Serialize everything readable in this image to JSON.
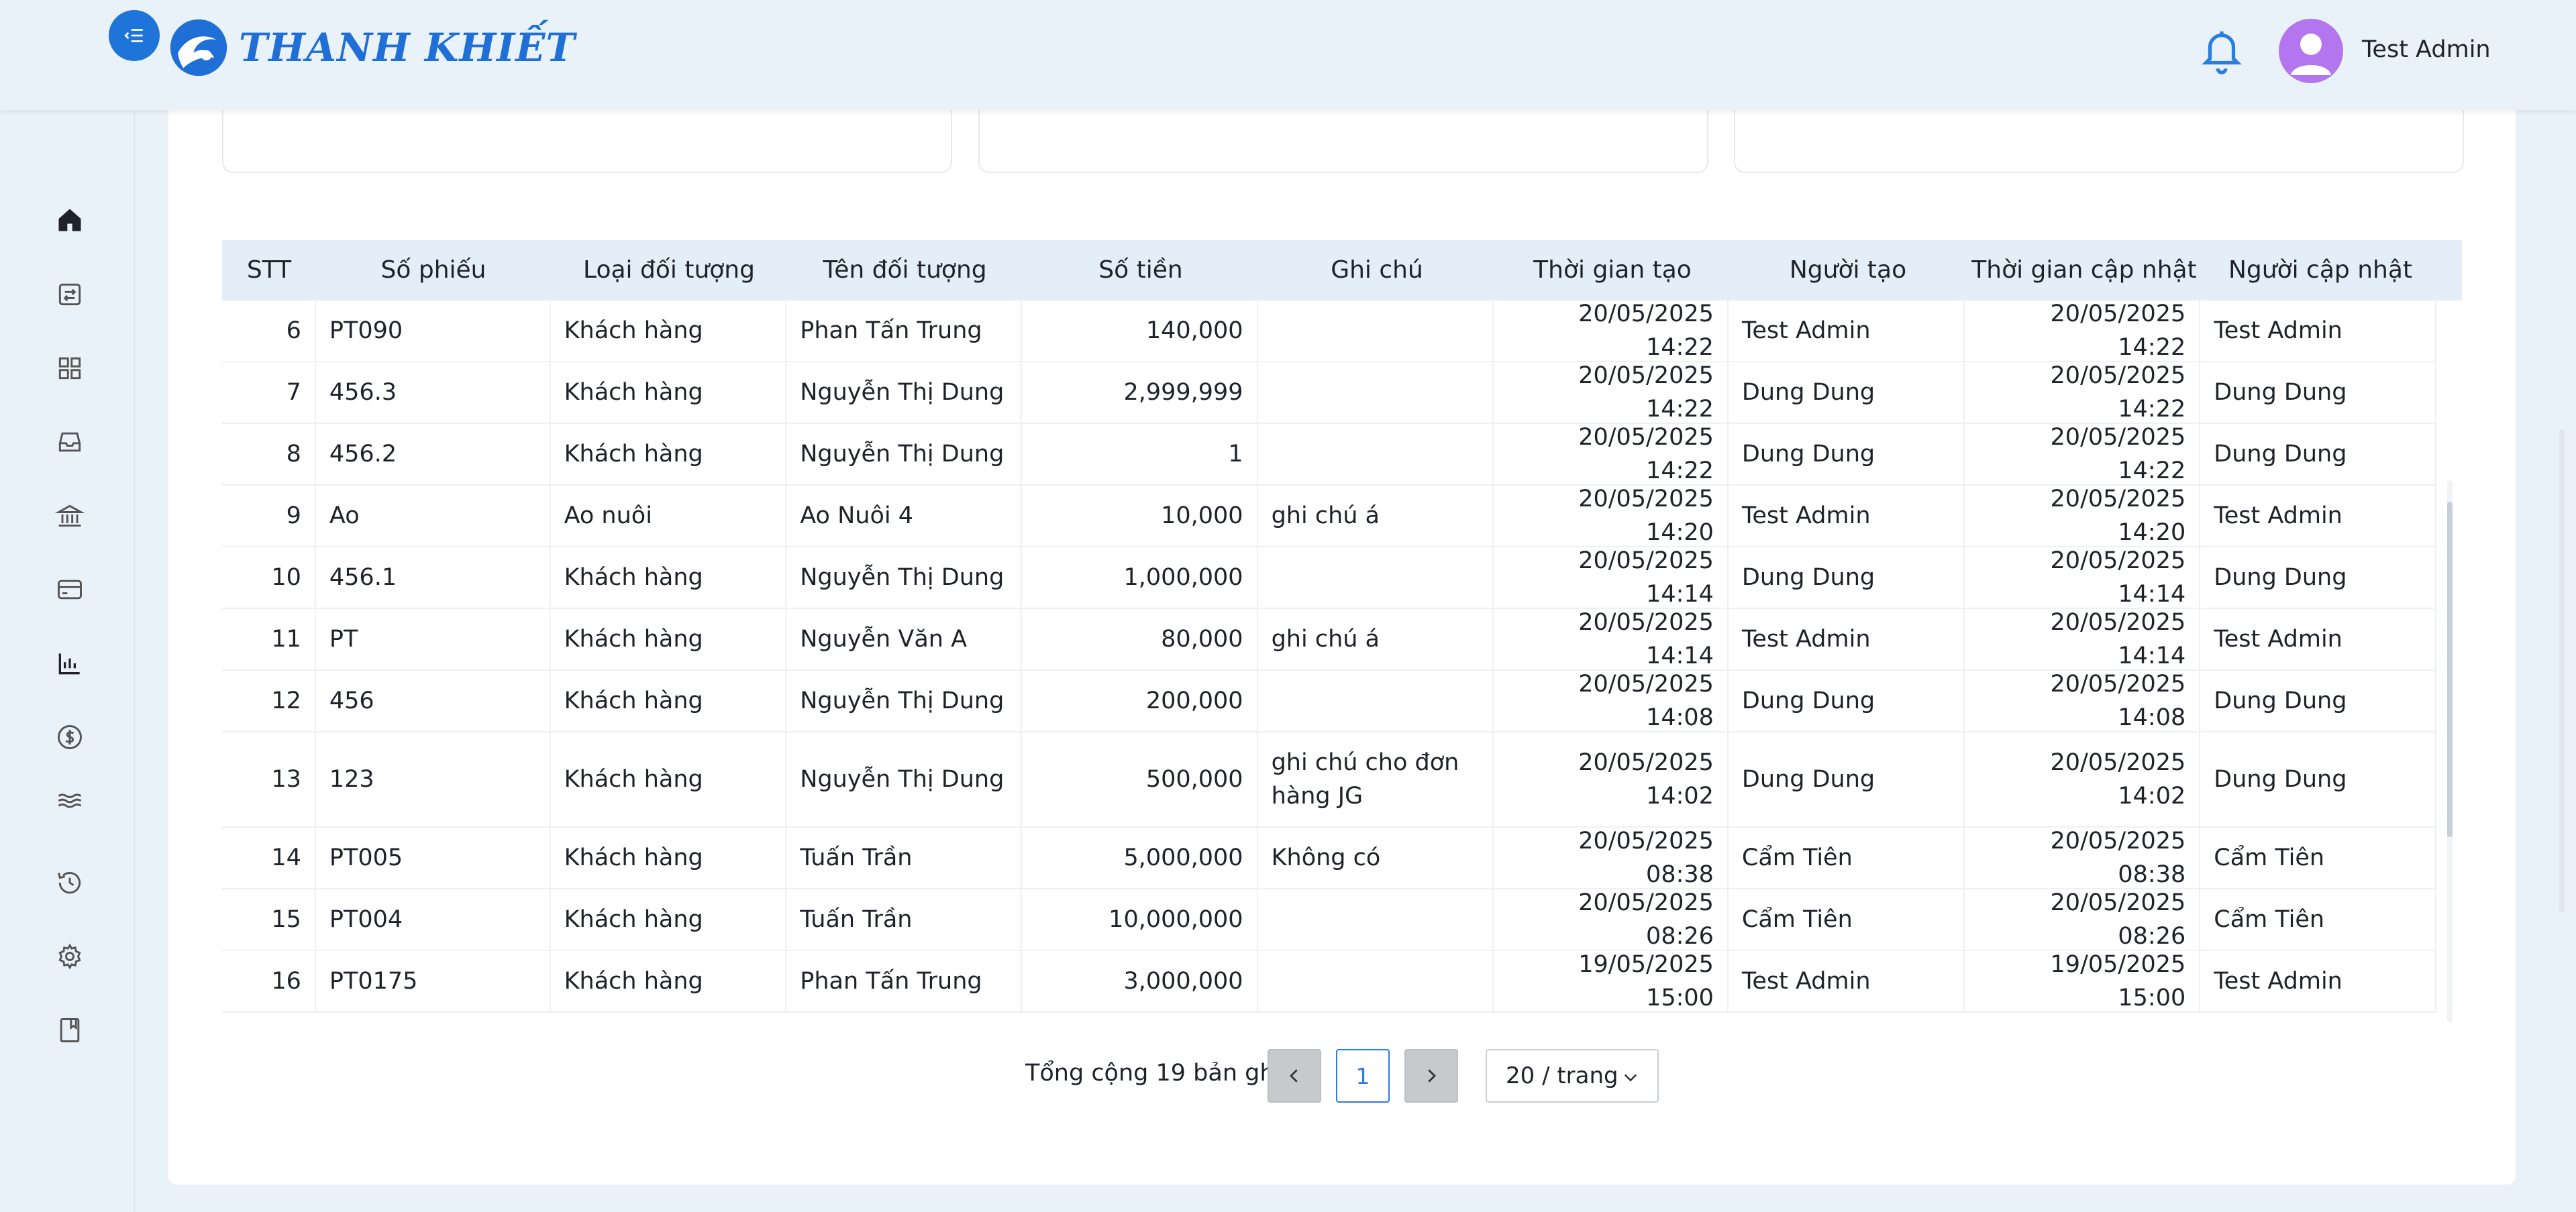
{
  "header": {
    "logo_text": "THANH KHIẾT",
    "user_name": "Test Admin"
  },
  "sidebar": {
    "items": [
      {
        "icon": "home-icon"
      },
      {
        "icon": "receipt-icon"
      },
      {
        "icon": "grid-icon"
      },
      {
        "icon": "inbox-icon"
      },
      {
        "icon": "bank-icon"
      },
      {
        "icon": "card-icon"
      },
      {
        "icon": "bar-chart-icon"
      },
      {
        "icon": "dollar-icon"
      },
      {
        "icon": "waves-icon"
      },
      {
        "icon": "history-icon"
      },
      {
        "icon": "gear-icon"
      },
      {
        "icon": "book-icon"
      }
    ]
  },
  "table": {
    "columns": [
      "STT",
      "Số phiếu",
      "Loại đối tượng",
      "Tên đối tượng",
      "Số tiền",
      "Ghi chú",
      "Thời gian tạo",
      "Người tạo",
      "Thời gian cập nhật",
      "Người cập nhật"
    ],
    "rows": [
      {
        "stt": "6",
        "so_phieu": "PT090",
        "loai": "Khách hàng",
        "ten": "Phan Tấn Trung",
        "so_tien": "140,000",
        "ghi_chu": "",
        "tg_tao": "20/05/2025 14:22",
        "nguoi_tao": "Test Admin",
        "tg_cap_nhat": "20/05/2025 14:22",
        "nguoi_cap_nhat": "Test Admin"
      },
      {
        "stt": "7",
        "so_phieu": "456.3",
        "loai": "Khách hàng",
        "ten": "Nguyễn Thị Dung",
        "so_tien": "2,999,999",
        "ghi_chu": "",
        "tg_tao": "20/05/2025 14:22",
        "nguoi_tao": "Dung Dung",
        "tg_cap_nhat": "20/05/2025 14:22",
        "nguoi_cap_nhat": "Dung Dung"
      },
      {
        "stt": "8",
        "so_phieu": "456.2",
        "loai": "Khách hàng",
        "ten": "Nguyễn Thị Dung",
        "so_tien": "1",
        "ghi_chu": "",
        "tg_tao": "20/05/2025 14:22",
        "nguoi_tao": "Dung Dung",
        "tg_cap_nhat": "20/05/2025 14:22",
        "nguoi_cap_nhat": "Dung Dung"
      },
      {
        "stt": "9",
        "so_phieu": "Ao",
        "loai": "Ao nuôi",
        "ten": "Ao Nuôi 4",
        "so_tien": "10,000",
        "ghi_chu": "ghi chú á",
        "tg_tao": "20/05/2025 14:20",
        "nguoi_tao": "Test Admin",
        "tg_cap_nhat": "20/05/2025 14:20",
        "nguoi_cap_nhat": "Test Admin"
      },
      {
        "stt": "10",
        "so_phieu": "456.1",
        "loai": "Khách hàng",
        "ten": "Nguyễn Thị Dung",
        "so_tien": "1,000,000",
        "ghi_chu": "",
        "tg_tao": "20/05/2025 14:14",
        "nguoi_tao": "Dung Dung",
        "tg_cap_nhat": "20/05/2025 14:14",
        "nguoi_cap_nhat": "Dung Dung"
      },
      {
        "stt": "11",
        "so_phieu": "PT",
        "loai": "Khách hàng",
        "ten": "Nguyễn Văn A",
        "so_tien": "80,000",
        "ghi_chu": "ghi chú á",
        "tg_tao": "20/05/2025 14:14",
        "nguoi_tao": "Test Admin",
        "tg_cap_nhat": "20/05/2025 14:14",
        "nguoi_cap_nhat": "Test Admin"
      },
      {
        "stt": "12",
        "so_phieu": "456",
        "loai": "Khách hàng",
        "ten": "Nguyễn Thị Dung",
        "so_tien": "200,000",
        "ghi_chu": "",
        "tg_tao": "20/05/2025 14:08",
        "nguoi_tao": "Dung Dung",
        "tg_cap_nhat": "20/05/2025 14:08",
        "nguoi_cap_nhat": "Dung Dung"
      },
      {
        "stt": "13",
        "so_phieu": "123",
        "loai": "Khách hàng",
        "ten": "Nguyễn Thị Dung",
        "so_tien": "500,000",
        "ghi_chu": "ghi chú cho đơn hàng JG",
        "tg_tao": "20/05/2025 14:02",
        "nguoi_tao": "Dung Dung",
        "tg_cap_nhat": "20/05/2025 14:02",
        "nguoi_cap_nhat": "Dung Dung"
      },
      {
        "stt": "14",
        "so_phieu": "PT005",
        "loai": "Khách hàng",
        "ten": "Tuấn Trần",
        "so_tien": "5,000,000",
        "ghi_chu": "Không có",
        "tg_tao": "20/05/2025 08:38",
        "nguoi_tao": "Cẩm Tiên",
        "tg_cap_nhat": "20/05/2025 08:38",
        "nguoi_cap_nhat": "Cẩm Tiên"
      },
      {
        "stt": "15",
        "so_phieu": "PT004",
        "loai": "Khách hàng",
        "ten": "Tuấn Trần",
        "so_tien": "10,000,000",
        "ghi_chu": "",
        "tg_tao": "20/05/2025 08:26",
        "nguoi_tao": "Cẩm Tiên",
        "tg_cap_nhat": "20/05/2025 08:26",
        "nguoi_cap_nhat": "Cẩm Tiên"
      },
      {
        "stt": "16",
        "so_phieu": "PT0175",
        "loai": "Khách hàng",
        "ten": "Phan Tấn Trung",
        "so_tien": "3,000,000",
        "ghi_chu": "",
        "tg_tao": "19/05/2025 15:00",
        "nguoi_tao": "Test Admin",
        "tg_cap_nhat": "19/05/2025 15:00",
        "nguoi_cap_nhat": "Test Admin"
      }
    ]
  },
  "pagination": {
    "total_text": "Tổng cộng 19 bản ghi",
    "current_page": "1",
    "page_size": "20 / trang"
  },
  "colors": {
    "accent": "#1e74d8",
    "header_bg": "#eaf2f9",
    "table_header_bg": "#e3eef9",
    "avatar_bg": "#b476ee"
  }
}
